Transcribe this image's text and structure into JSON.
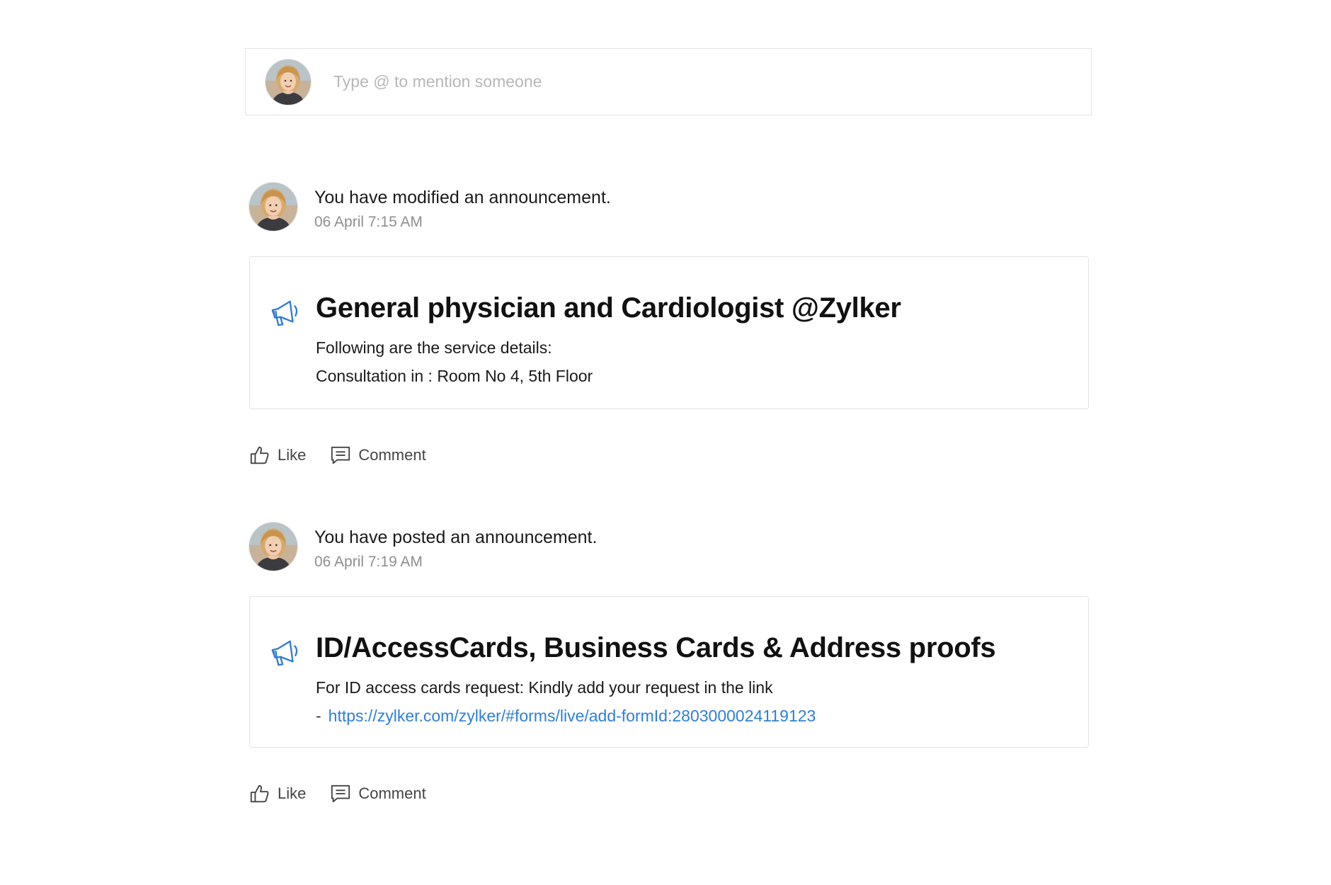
{
  "composer": {
    "placeholder": "Type @ to mention someone"
  },
  "feed": [
    {
      "action_text": "You have modified an announcement.",
      "timestamp": "06 April 7:15 AM",
      "title": "General physician and Cardiologist @Zylker",
      "lines": [
        "Following are the service details:",
        "Consultation in : Room No 4, 5th Floor"
      ],
      "like_label": "Like",
      "comment_label": "Comment"
    },
    {
      "action_text": "You have posted an announcement.",
      "timestamp": "06 April 7:19 AM",
      "title": "ID/AccessCards, Business Cards & Address proofs",
      "lines": [
        "For ID access cards request: Kindly add your request in the link"
      ],
      "link_prefix": "-",
      "link_text": "https://zylker.com/zylker/#forms/live/add-formId:2803000024119123",
      "like_label": "Like",
      "comment_label": "Comment"
    }
  ],
  "icons": {
    "megaphone": "megaphone-icon",
    "like": "thumbs-up-icon",
    "comment": "comment-icon",
    "avatar": "user-avatar"
  },
  "colors": {
    "accent": "#2f7fd6",
    "megaphone": "#2e7bd3",
    "border": "#e3e3e3",
    "muted_text": "#8f8f8f"
  }
}
